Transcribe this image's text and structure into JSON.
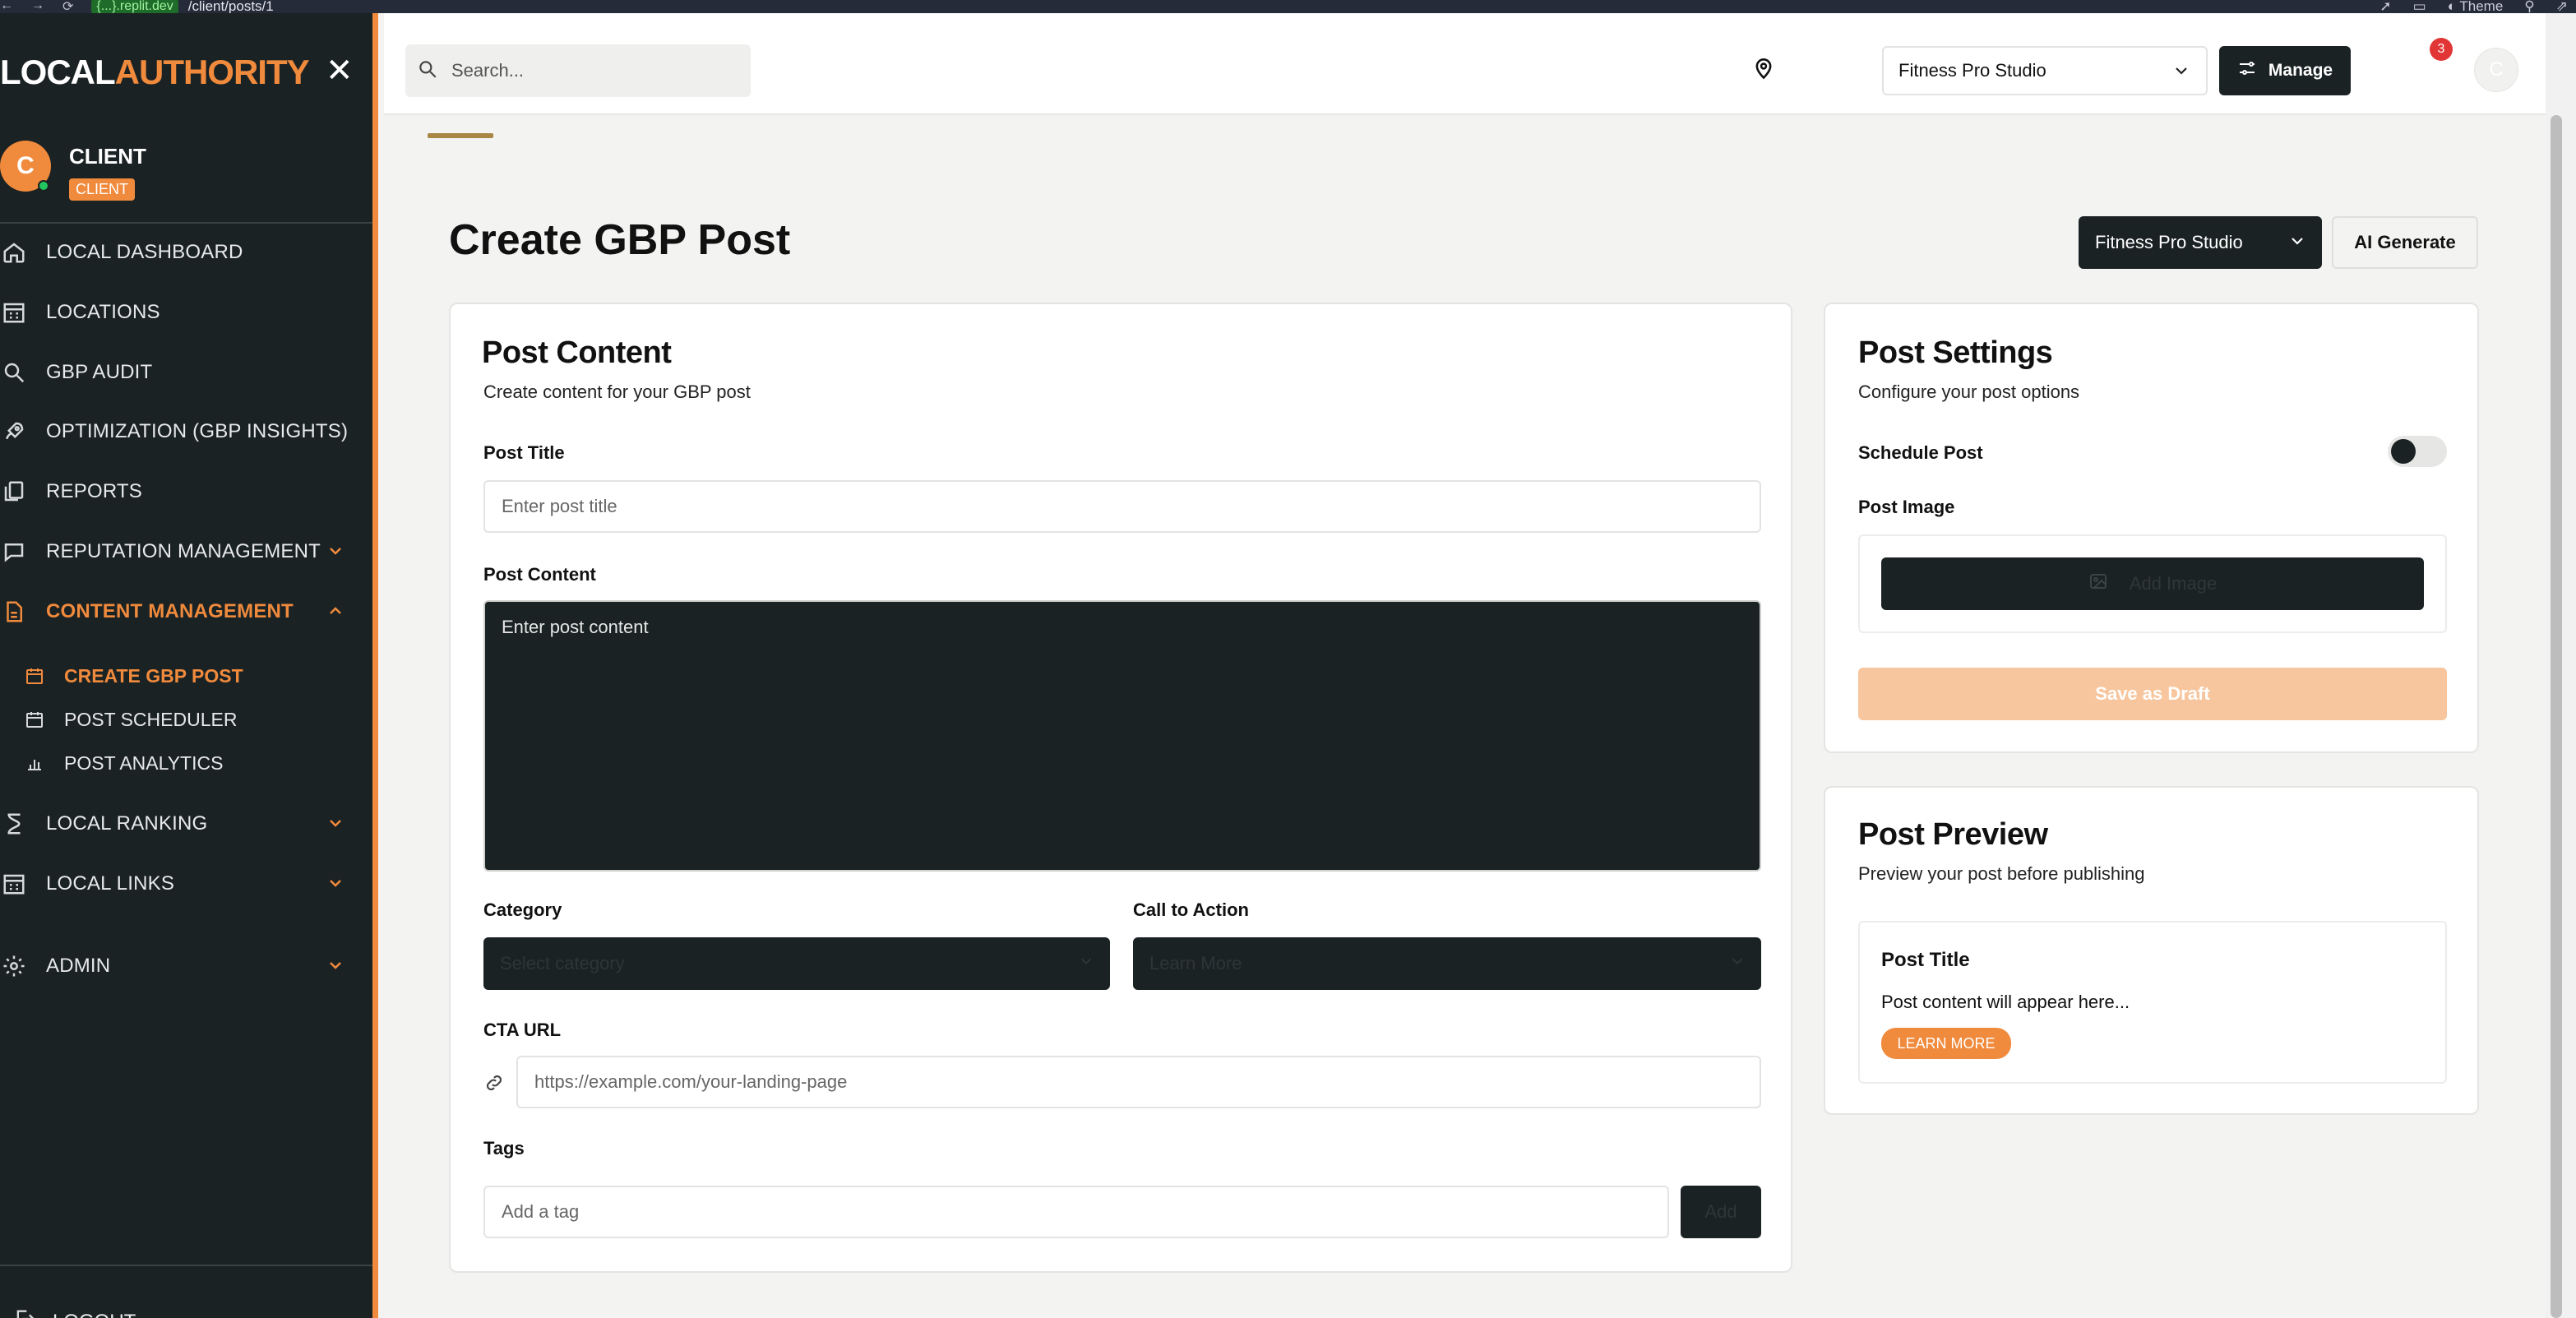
{
  "browser": {
    "domain": "{...}.replit.dev",
    "path": "/client/posts/1",
    "theme_label": "Theme"
  },
  "sidebar": {
    "logo_part1": "LOCAL",
    "logo_part2": "AUTHORITY",
    "profile": {
      "initial": "C",
      "name": "CLIENT",
      "badge": "CLIENT"
    },
    "items": [
      {
        "label": "LOCAL DASHBOARD",
        "icon": "home-icon"
      },
      {
        "label": "LOCATIONS",
        "icon": "building-icon"
      },
      {
        "label": "GBP AUDIT",
        "icon": "search-icon"
      },
      {
        "label": "OPTIMIZATION (GBP INSIGHTS)",
        "icon": "rocket-icon"
      },
      {
        "label": "REPORTS",
        "icon": "copy-icon"
      },
      {
        "label": "REPUTATION MANAGEMENT",
        "icon": "chat-icon"
      },
      {
        "label": "CONTENT MANAGEMENT",
        "icon": "file-icon"
      },
      {
        "label": "LOCAL RANKING",
        "icon": "hourglass-icon"
      },
      {
        "label": "LOCAL LINKS",
        "icon": "building-icon"
      },
      {
        "label": "ADMIN",
        "icon": "gear-icon"
      }
    ],
    "sub_items": [
      {
        "label": "CREATE GBP POST",
        "icon": "calendar-icon"
      },
      {
        "label": "POST SCHEDULER",
        "icon": "calendar-icon"
      },
      {
        "label": "POST ANALYTICS",
        "icon": "bar-chart-icon"
      }
    ],
    "logout": "LOGOUT"
  },
  "header": {
    "search_placeholder": "Search...",
    "location_select": "Fitness Pro Studio",
    "manage_label": "Manage",
    "notification_count": "3",
    "user_initial": "C"
  },
  "page": {
    "title": "Create GBP Post",
    "location_select": "Fitness Pro Studio",
    "ai_generate": "AI Generate",
    "progress_fraction": 0.03
  },
  "post_content": {
    "title": "Post Content",
    "subtitle": "Create content for your GBP post",
    "post_title_label": "Post Title",
    "post_title_placeholder": "Enter post title",
    "post_content_label": "Post Content",
    "post_content_placeholder": "Enter post content",
    "category_label": "Category",
    "category_placeholder": "Select category",
    "cta_label": "Call to Action",
    "cta_value": "Learn More",
    "cta_url_label": "CTA URL",
    "cta_url_placeholder": "https://example.com/your-landing-page",
    "tags_label": "Tags",
    "tags_placeholder": "Add a tag",
    "add_label": "Add"
  },
  "post_settings": {
    "title": "Post Settings",
    "subtitle": "Configure your post options",
    "schedule_label": "Schedule Post",
    "schedule_on": false,
    "image_label": "Post Image",
    "add_image": "Add Image",
    "save_draft": "Save as Draft"
  },
  "post_preview": {
    "title": "Post Preview",
    "subtitle": "Preview your post before publishing",
    "preview_title": "Post Title",
    "preview_body": "Post content will appear here...",
    "learn_more": "LEARN MORE"
  },
  "colors": {
    "accent": "#f08a3c",
    "sidebar_bg": "#1b2224",
    "page_bg": "#f3f3f2"
  }
}
